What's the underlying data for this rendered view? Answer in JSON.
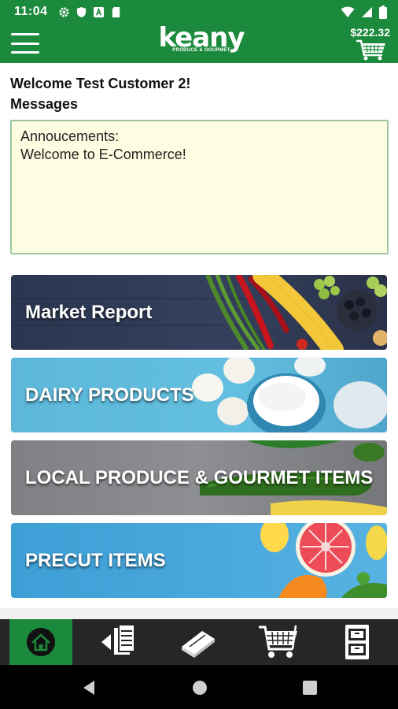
{
  "status_bar": {
    "time": "11:04",
    "icons": [
      "gear-icon",
      "shield-icon",
      "a-badge-icon",
      "sd-card-icon",
      "wifi-icon",
      "signal-icon",
      "battery-icon"
    ]
  },
  "header": {
    "brand": "keany",
    "brand_tagline": "PRODUCE & GOURMET",
    "cart_total": "$222.32",
    "bg_color": "#1b8a3c"
  },
  "welcome_text": "Welcome Test Customer 2!",
  "messages_label": "Messages",
  "message_box": {
    "lines": [
      "Annoucements:",
      "Welcome to E-Commerce!"
    ]
  },
  "tiles": [
    {
      "label": "Market Report"
    },
    {
      "label": "DAIRY PRODUCTS"
    },
    {
      "label": "LOCAL PRODUCE & GOURMET ITEMS"
    },
    {
      "label": "PRECUT ITEMS"
    }
  ],
  "bottom_tabs": [
    {
      "icon": "home-icon",
      "active": true
    },
    {
      "icon": "order-list-icon",
      "active": false
    },
    {
      "icon": "catalog-book-icon",
      "active": false
    },
    {
      "icon": "cart-icon",
      "active": false
    },
    {
      "icon": "cabinet-icon",
      "active": false
    }
  ],
  "android_nav": [
    "back-icon",
    "home-circle-icon",
    "recents-icon"
  ]
}
